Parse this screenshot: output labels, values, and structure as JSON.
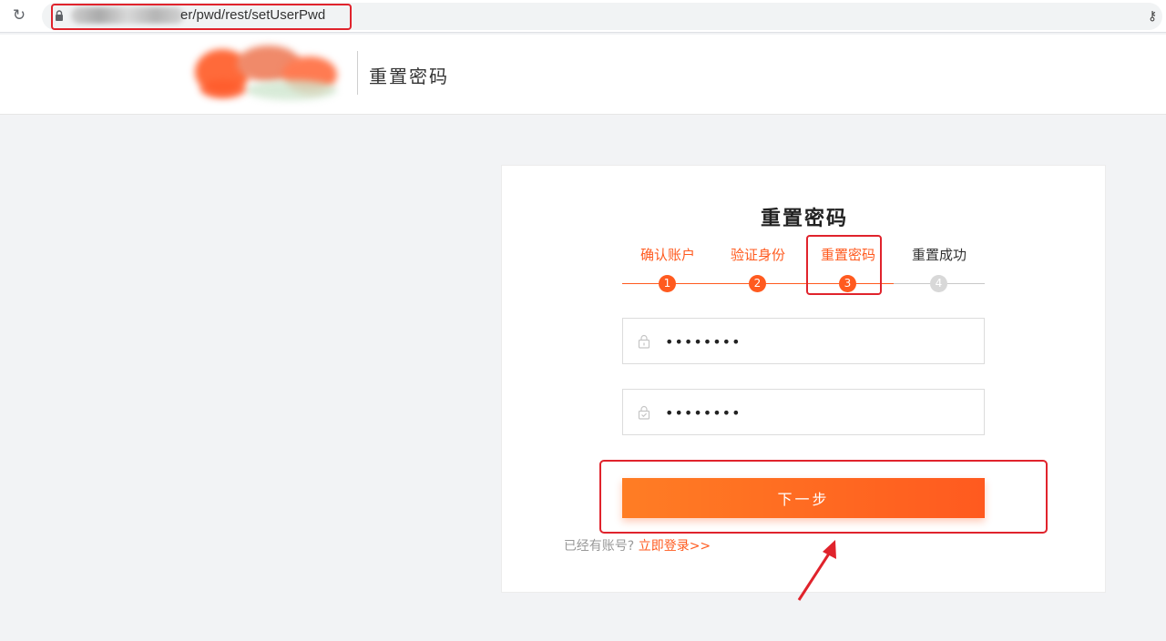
{
  "browser": {
    "url_visible": "er/pwd/rest/setUserPwd"
  },
  "header": {
    "title": "重置密码"
  },
  "card": {
    "title": "重置密码",
    "steps": [
      {
        "label": "确认账户",
        "number": "1",
        "state": "done"
      },
      {
        "label": "验证身份",
        "number": "2",
        "state": "done"
      },
      {
        "label": "重置密码",
        "number": "3",
        "state": "active"
      },
      {
        "label": "重置成功",
        "number": "4",
        "state": "pending"
      }
    ],
    "password_value": "••••••••",
    "confirm_value": "••••••••",
    "next_label": "下一步",
    "login_question": "已经有账号?",
    "login_link": "立即登录>>"
  },
  "colors": {
    "accent": "#ff5a1f",
    "annotation": "#e0232c"
  }
}
